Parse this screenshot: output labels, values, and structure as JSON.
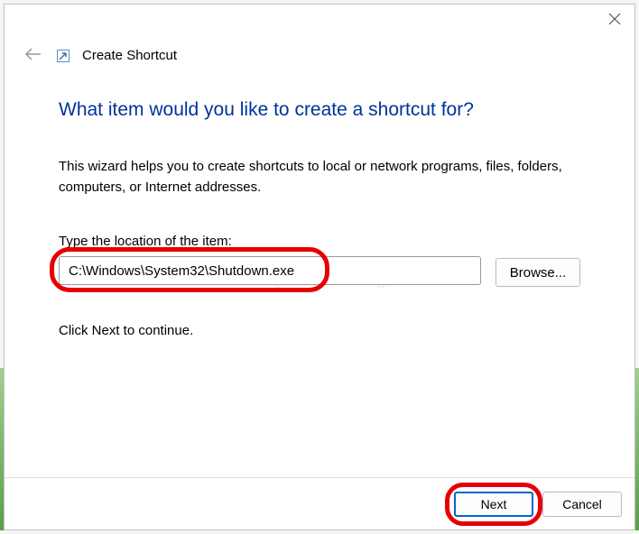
{
  "header": {
    "title": "Create Shortcut"
  },
  "main": {
    "heading": "What item would you like to create a shortcut for?",
    "description": "This wizard helps you to create shortcuts to local or network programs, files, folders, computers, or Internet addresses.",
    "input_label": "Type the location of the item:",
    "input_value": "C:\\Windows\\System32\\Shutdown.exe",
    "browse_label": "Browse...",
    "continue_text": "Click Next to continue."
  },
  "footer": {
    "next_label": "Next",
    "cancel_label": "Cancel"
  },
  "watermark": "©Quantrimang"
}
